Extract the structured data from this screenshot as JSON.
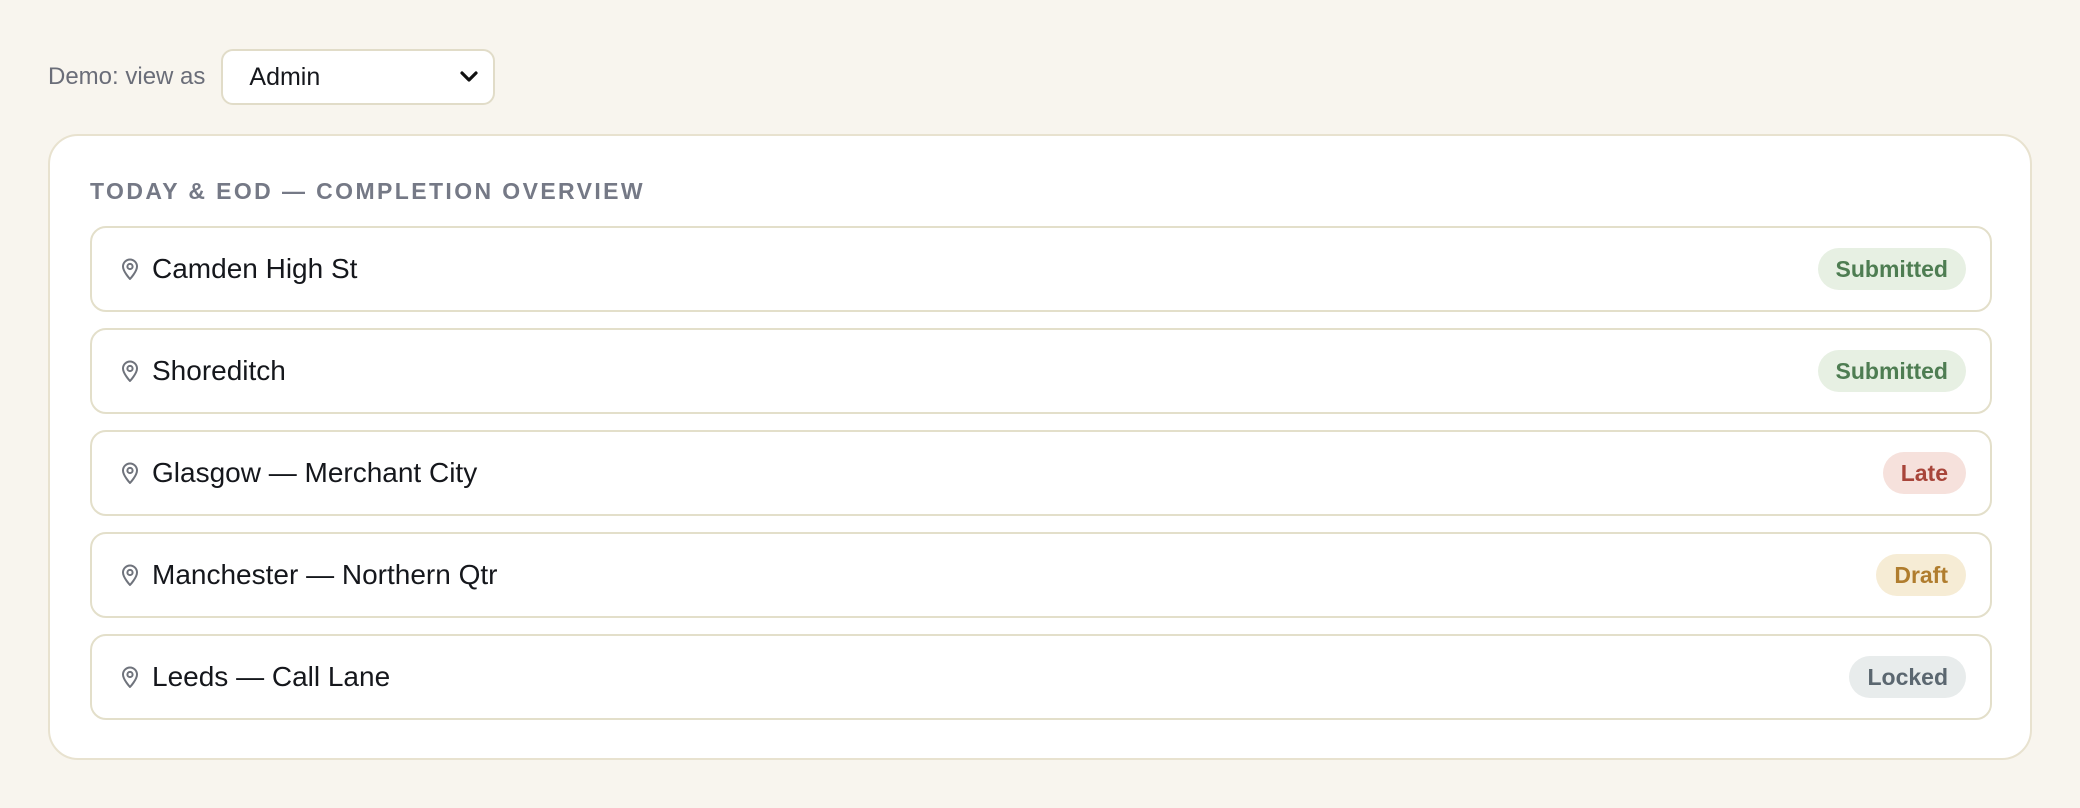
{
  "header": {
    "view_as_label": "Demo: view as",
    "role_select": {
      "value": "Admin",
      "options": [
        "Admin"
      ]
    }
  },
  "panel": {
    "title": "TODAY & EOD — COMPLETION OVERVIEW",
    "rows": [
      {
        "location": "Camden High St",
        "status": "Submitted",
        "status_kind": "submitted"
      },
      {
        "location": "Shoreditch",
        "status": "Submitted",
        "status_kind": "submitted"
      },
      {
        "location": "Glasgow — Merchant City",
        "status": "Late",
        "status_kind": "late"
      },
      {
        "location": "Manchester — Northern Qtr",
        "status": "Draft",
        "status_kind": "draft"
      },
      {
        "location": "Leeds — Call Lane",
        "status": "Locked",
        "status_kind": "locked"
      }
    ]
  },
  "status_colors": {
    "submitted": {
      "text": "#4e7d52",
      "bg": "#e7f0e3"
    },
    "late": {
      "text": "#a8453a",
      "bg": "#f6e1dc"
    },
    "draft": {
      "text": "#b07d2e",
      "bg": "#f6ecd5"
    },
    "locked": {
      "text": "#5b6770",
      "bg": "#e8ecec"
    }
  },
  "icons": {
    "location": "map-pin-icon",
    "select_caret": "chevron-down-icon"
  }
}
